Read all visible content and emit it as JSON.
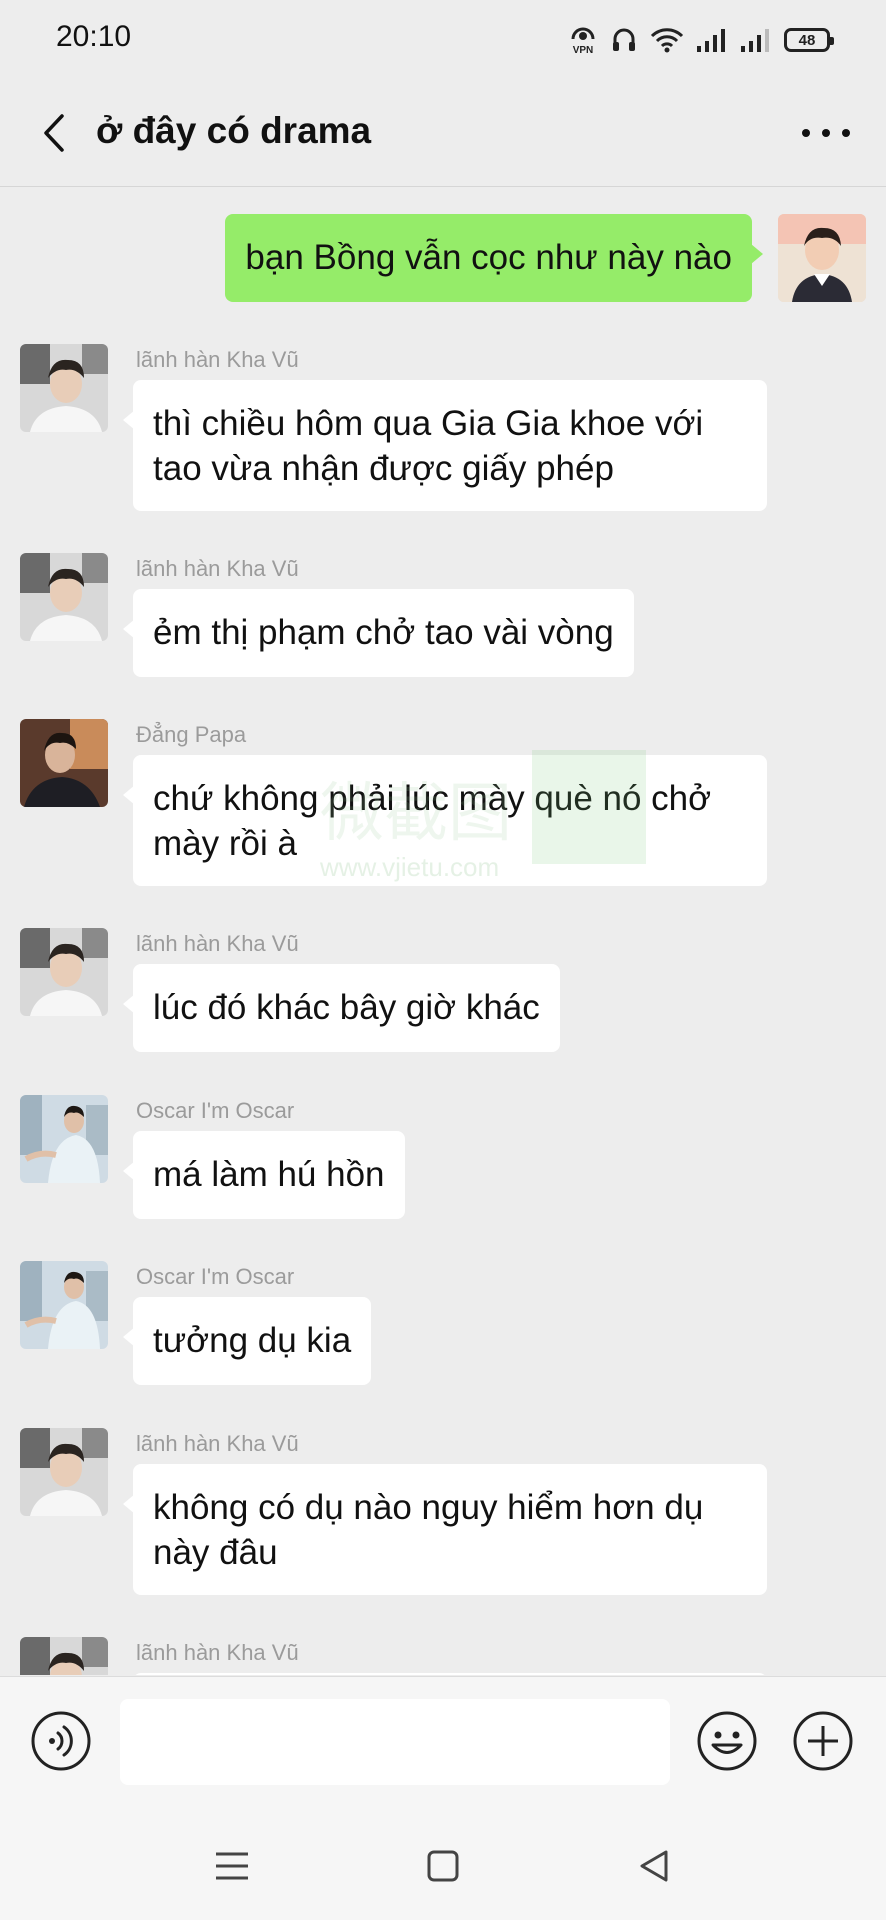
{
  "status_bar": {
    "time": "20:10",
    "vpn": "VPN",
    "battery": "48"
  },
  "header": {
    "title": "ở đây có drama"
  },
  "messages": [
    {
      "sender": "",
      "text": "bạn Bồng vẫn cọc như này nào",
      "self": true
    },
    {
      "sender": "lãnh hàn Kha Vũ",
      "text": "thì chiều hôm qua Gia Gia khoe với tao vừa nhận được giấy phép"
    },
    {
      "sender": "lãnh hàn Kha Vũ",
      "text": "ẻm thị phạm chở tao vài vòng"
    },
    {
      "sender": "Đẳng Papa",
      "text": "chứ không phải lúc mày què nó chở mày rồi à"
    },
    {
      "sender": "lãnh hàn Kha Vũ",
      "text": "lúc đó khác bây giờ khác"
    },
    {
      "sender": "Oscar I'm Oscar",
      "text": "má làm hú hồn"
    },
    {
      "sender": "Oscar I'm Oscar",
      "text": "tưởng dụ kia"
    },
    {
      "sender": "lãnh hàn Kha Vũ",
      "text": "không có dụ nào nguy hiểm hơn dụ này đâu"
    },
    {
      "sender": "lãnh hàn Kha Vũ",
      "text": ""
    }
  ],
  "watermark": {
    "line1": "微截图",
    "line2": "www.vjietu.com"
  },
  "input": {
    "placeholder": ""
  },
  "colors": {
    "background": "#ededed",
    "self_bubble": "#95ec69",
    "other_bubble": "#ffffff",
    "sender_name": "#9b9b9b"
  }
}
